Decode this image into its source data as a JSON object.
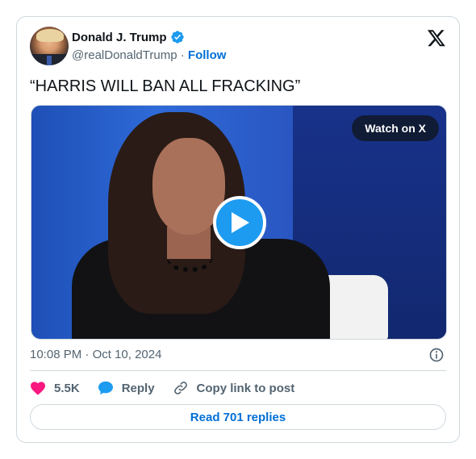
{
  "author": {
    "name": "Donald J. Trump",
    "handle": "@realDonaldTrump",
    "separator": "·",
    "follow_label": "Follow",
    "verified": true,
    "avatar_icon": "profile-photo"
  },
  "tweet": {
    "text": "“HARRIS WILL BAN ALL FRACKING”",
    "time": "10:08 PM",
    "date": "Oct 10, 2024"
  },
  "media": {
    "watch_label": "Watch on X",
    "play_icon": "play-icon"
  },
  "actions": {
    "like_count": "5.5K",
    "reply_label": "Reply",
    "copy_label": "Copy link to post"
  },
  "replies": {
    "label": "Read 701 replies"
  },
  "colors": {
    "link_blue": "#006fd6",
    "verified_blue": "#1d9bf0",
    "heart_pink": "#f91880",
    "border": "#cfd9de",
    "muted_text": "#536471"
  }
}
